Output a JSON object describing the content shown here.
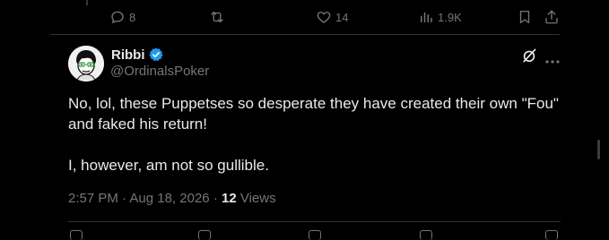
{
  "previous_tweet_actions": {
    "replies": "8",
    "reposts": "",
    "likes": "14",
    "views": "1.9K"
  },
  "tweet": {
    "display_name": "Ribbi",
    "handle": "@OrdinalsPoker",
    "text_line1": "No, lol, these Puppetses so desperate they have created their own \"Fou\" and faked his return!",
    "text_line2": "I, however, am not so gullible.",
    "time": "2:57 PM",
    "separator": "·",
    "date": "Aug 18, 2026",
    "views_count": "12",
    "views_label": "Views"
  },
  "colors": {
    "background": "#000000",
    "text_primary": "#e7e9ea",
    "text_secondary": "#71767b",
    "verified_blue": "#1d9bf0",
    "divider": "#2f3336"
  },
  "icons": {
    "reply": "reply-icon",
    "repost": "repost-icon",
    "like": "heart-icon",
    "views": "analytics-icon",
    "bookmark": "bookmark-icon",
    "share": "share-icon",
    "verified": "verified-badge-icon",
    "grok": "grok-icon",
    "more": "more-icon"
  }
}
